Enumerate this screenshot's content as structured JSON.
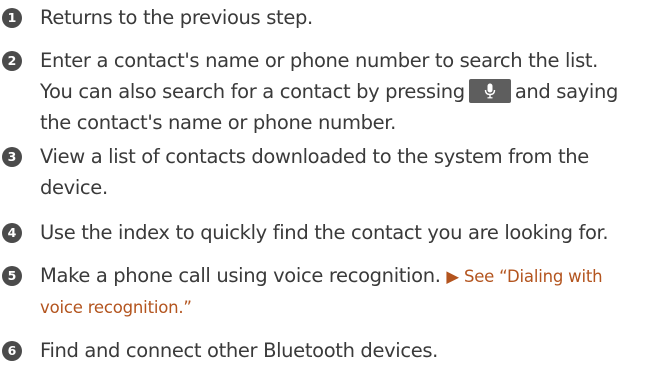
{
  "items": [
    {
      "number": "1",
      "lines": [
        "Returns to the previous step."
      ]
    },
    {
      "number": "2",
      "line1": "Enter a contact's name or phone number to search the list.",
      "line2_before": "You can also search for a contact by pressing",
      "line2_after": "and saying",
      "line3": "the contact's name or phone number.",
      "icon": "microphone-icon"
    },
    {
      "number": "3",
      "line1": "View a list of contacts downloaded to the system from the",
      "line2": "device."
    },
    {
      "number": "4",
      "line1": "Use the index to quickly find the contact you are looking for."
    },
    {
      "number": "5",
      "line1": "Make a phone call using voice recognition.",
      "ref1": "▶ See “Dialing with",
      "ref2": "voice recognition.”"
    },
    {
      "number": "6",
      "line1": "Find and connect other Bluetooth devices."
    }
  ],
  "colors": {
    "text": "#3a3a3a",
    "number_circle": "#4b4b4b",
    "reference": "#b3541e",
    "mic_button": "#5e5e5e"
  }
}
